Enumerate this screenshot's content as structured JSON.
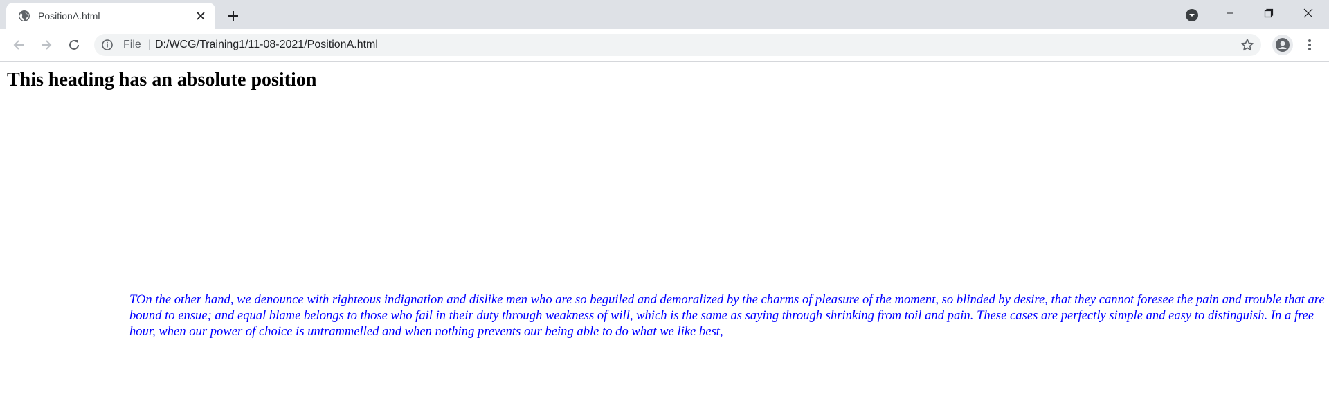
{
  "browser": {
    "tab": {
      "title": "PositionA.html"
    },
    "address_bar": {
      "scheme_label": "File",
      "separator": "|",
      "url": "D:/WCG/Training1/11-08-2021/PositionA.html"
    }
  },
  "page": {
    "heading": "This heading has an absolute position",
    "paragraph": "TOn the other hand, we denounce with righteous indignation and dislike men who are so beguiled and demoralized by the charms of pleasure of the moment, so blinded by desire, that they cannot foresee the pain and trouble that are bound to ensue; and equal blame belongs to those who fail in their duty through weakness of will, which is the same as saying through shrinking from toil and pain. These cases are perfectly simple and easy to distinguish. In a free hour, when our power of choice is untrammelled and when nothing prevents our being able to do what we like best,"
  },
  "colors": {
    "tabstrip_bg": "#dee1e6",
    "omnibox_bg": "#f1f3f4",
    "paragraph_text": "#0000ff",
    "heading_text": "#000000"
  },
  "icons": {
    "tab_favicon": "globe-icon",
    "tab_close": "close-icon",
    "new_tab": "plus-icon",
    "tab_search": "tab-search-icon",
    "minimize": "minimize-icon",
    "restore": "restore-icon",
    "close_window": "close-window-icon",
    "back": "back-arrow-icon",
    "forward": "forward-arrow-icon",
    "reload": "reload-icon",
    "site_info": "info-icon",
    "bookmark": "star-icon",
    "profile": "profile-icon",
    "menu": "kebab-menu-icon"
  }
}
